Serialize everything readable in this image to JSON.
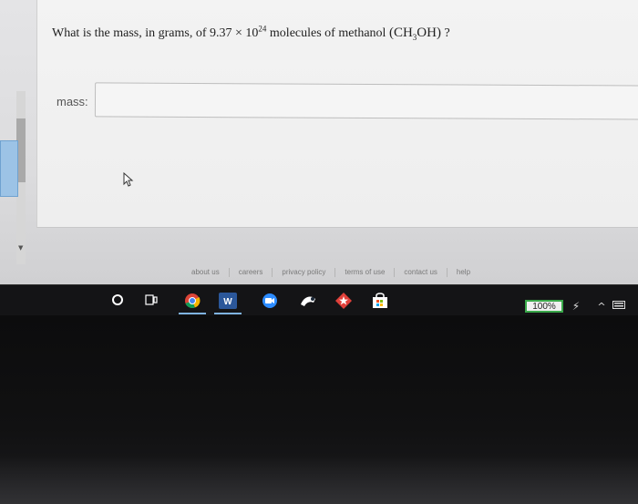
{
  "question": {
    "prefix": "What is the mass, in grams, of 9.37 × 10",
    "exponent": "24",
    "middle": " molecules of methanol ",
    "formula_open": "(CH",
    "formula_sub": "3",
    "formula_close": "OH)",
    "suffix": " ?"
  },
  "answer": {
    "label": "mass:",
    "value": "",
    "placeholder": ""
  },
  "footer_links": [
    "about us",
    "careers",
    "privacy policy",
    "terms of use",
    "contact us",
    "help"
  ],
  "taskbar": {
    "icons": [
      "search-icon",
      "task-view-icon",
      "chrome-icon",
      "word-icon",
      "zoom-icon",
      "steam-icon",
      "star-app-icon",
      "store-icon"
    ],
    "word_letter": "W",
    "battery_percent": "100%",
    "plug_glyph": "⚡",
    "chevron_glyph": "^"
  },
  "colors": {
    "battery_border": "#3aa84a",
    "word": "#2b579a",
    "zoom": "#2d8cff",
    "star_app": "#e0403a",
    "left_panel": "#9cc3e6"
  }
}
